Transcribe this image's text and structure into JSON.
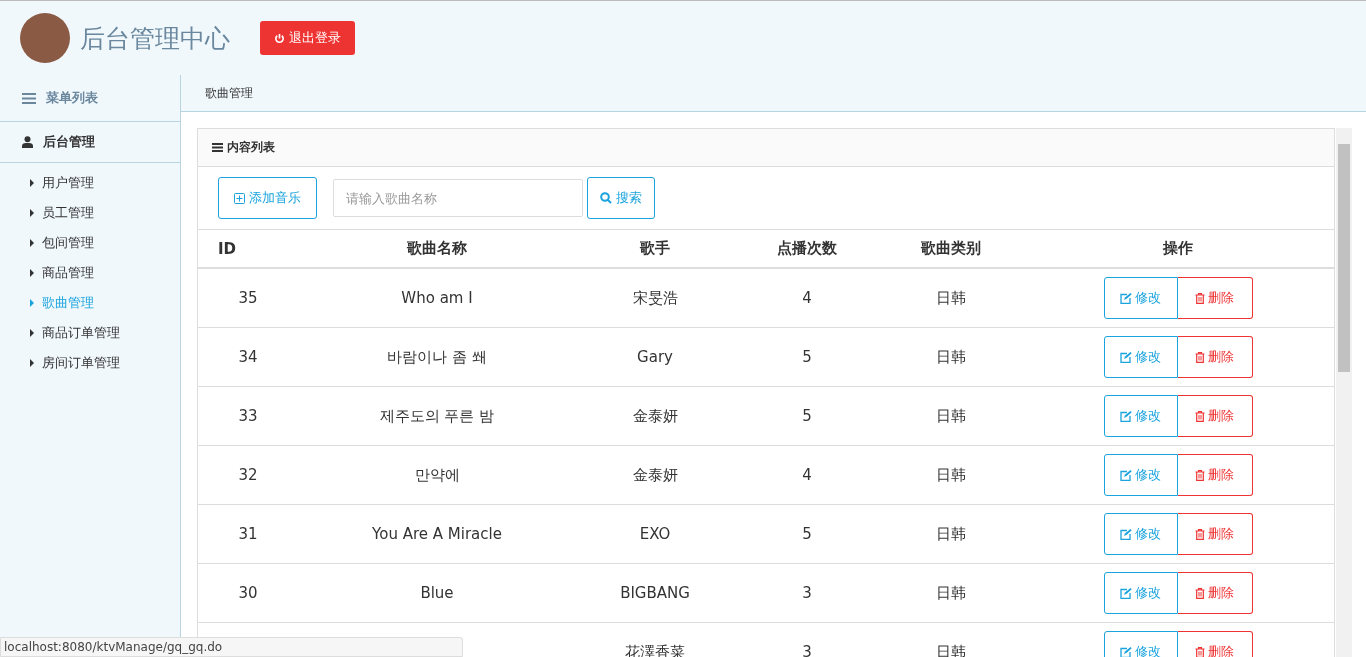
{
  "header": {
    "title": "后台管理中心",
    "logout_button": "退出登录"
  },
  "sidebar": {
    "title": "菜单列表",
    "section": "后台管理",
    "items": [
      {
        "label": "用户管理",
        "selected": false
      },
      {
        "label": "员工管理",
        "selected": false
      },
      {
        "label": "包间管理",
        "selected": false
      },
      {
        "label": "商品管理",
        "selected": false
      },
      {
        "label": "歌曲管理",
        "selected": true
      },
      {
        "label": "商品订单管理",
        "selected": false
      },
      {
        "label": "房间订单管理",
        "selected": false
      }
    ]
  },
  "breadcrumb": "歌曲管理",
  "panel": {
    "title": "内容列表",
    "add_button": "添加音乐",
    "search": {
      "placeholder": "请输入歌曲名称"
    },
    "search_button": "搜索"
  },
  "table": {
    "columns": [
      "ID",
      "歌曲名称",
      "歌手",
      "点播次数",
      "歌曲类别",
      "操作"
    ],
    "rows": [
      {
        "id": "35",
        "name": "Who am I",
        "singer": "宋旻浩",
        "plays": "4",
        "category": "日韩",
        "edit": "修改",
        "delete": "删除"
      },
      {
        "id": "34",
        "name": "바람이나 좀 쐐",
        "singer": "Gary",
        "plays": "5",
        "category": "日韩",
        "edit": "修改",
        "delete": "删除"
      },
      {
        "id": "33",
        "name": "제주도의 푸른 밤",
        "singer": "金泰妍",
        "plays": "5",
        "category": "日韩",
        "edit": "修改",
        "delete": "删除"
      },
      {
        "id": "32",
        "name": "만약에",
        "singer": "金泰妍",
        "plays": "4",
        "category": "日韩",
        "edit": "修改",
        "delete": "删除"
      },
      {
        "id": "31",
        "name": "You Are A Miracle",
        "singer": "EXO",
        "plays": "5",
        "category": "日韩",
        "edit": "修改",
        "delete": "删除"
      },
      {
        "id": "30",
        "name": "Blue",
        "singer": "BIGBANG",
        "plays": "3",
        "category": "日韩",
        "edit": "修改",
        "delete": "删除"
      },
      {
        "singer": "花澤香菜",
        "plays": "3",
        "category": "日韩",
        "edit": "修改",
        "delete": "删除"
      }
    ]
  },
  "status_bar": "localhost:8080/ktvManage/gq_gq.do"
}
